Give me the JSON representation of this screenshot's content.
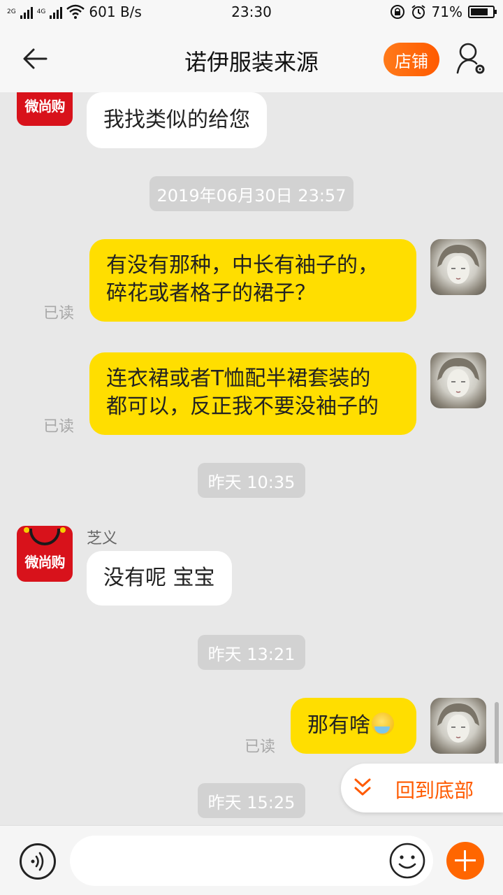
{
  "status_bar": {
    "network_a": "2G",
    "network_b": "4G",
    "speed": "601 B/s",
    "time": "23:30",
    "battery": "71%"
  },
  "header": {
    "title": "诺伊服装来源",
    "shop_button": "店铺"
  },
  "messages": [
    {
      "side": "left",
      "text": "我找类似的给您"
    },
    {
      "timestamp": "2019年06月30日 23:57"
    },
    {
      "side": "right",
      "line1": "有没有那种，中长有袖子的，",
      "line2": "碎花或者格子的裙子？",
      "status": "已读"
    },
    {
      "side": "right",
      "line1": "连衣裙或者T恤配半裙套装的",
      "line2": "都可以，反正我不要没袖子的",
      "status": "已读"
    },
    {
      "timestamp": "昨天  10:35"
    },
    {
      "side": "left",
      "sender": "芝义",
      "text": "没有呢 宝宝"
    },
    {
      "timestamp": "昨天  13:21"
    },
    {
      "side": "right",
      "text": "那有啥",
      "emoji": "crying-laughing-emoji",
      "status": "已读"
    },
    {
      "timestamp": "昨天  15:25"
    }
  ],
  "shop_avatar": {
    "logo_text": "微尚购",
    "color": "#d8121b"
  },
  "back_to_bottom": {
    "label": "回到底部",
    "color": "#ff5a00"
  },
  "input": {
    "value": "",
    "placeholder": ""
  },
  "colors": {
    "accent": "#ff6600",
    "own_bubble": "#ffde00",
    "their_bubble": "#ffffff"
  }
}
